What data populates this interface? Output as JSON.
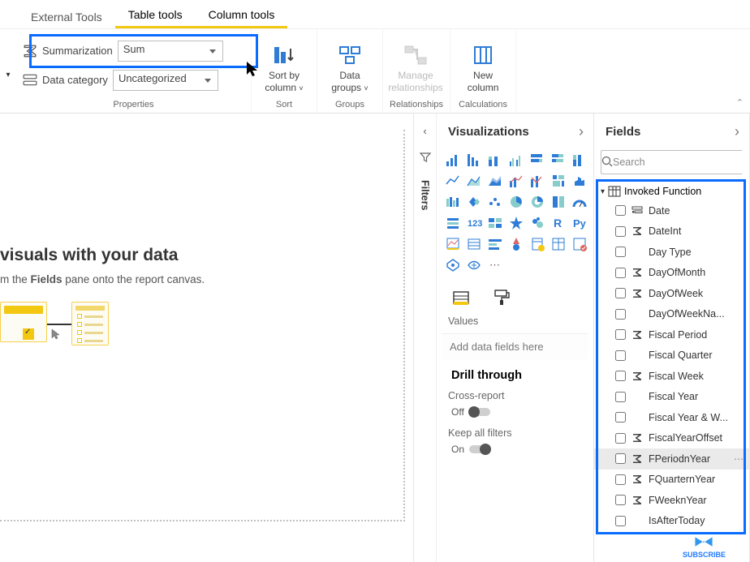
{
  "tabs": {
    "external": "External Tools",
    "table": "Table tools",
    "column": "Column tools"
  },
  "ribbon": {
    "summarization_label": "Summarization",
    "summarization_value": "Sum",
    "datacat_label": "Data category",
    "datacat_value": "Uncategorized",
    "properties_group": "Properties",
    "sort_label1": "Sort by",
    "sort_label2": "column",
    "sort_group": "Sort",
    "groups_label1": "Data",
    "groups_label2": "groups",
    "groups_group": "Groups",
    "rel_label1": "Manage",
    "rel_label2": "relationships",
    "rel_group": "Relationships",
    "new_label1": "New",
    "new_label2": "column",
    "calc_group": "Calculations"
  },
  "canvas": {
    "title_fragment": "visuals with your data",
    "body_prefix": "m the ",
    "body_bold": "Fields",
    "body_suffix": " pane onto the report canvas."
  },
  "filters_rail": "Filters",
  "viz": {
    "title": "Visualizations",
    "values_heading": "Values",
    "add_placeholder": "Add data fields here",
    "drill_heading": "Drill through",
    "cross_label": "Cross-report",
    "off_text": "Off",
    "keep_label": "Keep all filters",
    "on_text": "On"
  },
  "fields": {
    "title": "Fields",
    "search_placeholder": "Search",
    "table_name": "Invoked Function",
    "items": [
      {
        "name": "Date",
        "icon": "hierarchy"
      },
      {
        "name": "DateInt",
        "icon": "sigma"
      },
      {
        "name": "Day Type",
        "icon": "none"
      },
      {
        "name": "DayOfMonth",
        "icon": "sigma"
      },
      {
        "name": "DayOfWeek",
        "icon": "sigma"
      },
      {
        "name": "DayOfWeekNa...",
        "icon": "none"
      },
      {
        "name": "Fiscal Period",
        "icon": "sigma"
      },
      {
        "name": "Fiscal Quarter",
        "icon": "none"
      },
      {
        "name": "Fiscal Week",
        "icon": "sigma"
      },
      {
        "name": "Fiscal Year",
        "icon": "none"
      },
      {
        "name": "Fiscal Year & W...",
        "icon": "none"
      },
      {
        "name": "FiscalYearOffset",
        "icon": "sigma"
      },
      {
        "name": "FPeriodnYear",
        "icon": "sigma",
        "selected": true,
        "dots": true
      },
      {
        "name": "FQuarternYear",
        "icon": "sigma"
      },
      {
        "name": "FWeeknYear",
        "icon": "sigma"
      },
      {
        "name": "IsAfterToday",
        "icon": "none"
      }
    ]
  },
  "subscribe": "SUBSCRIBE"
}
